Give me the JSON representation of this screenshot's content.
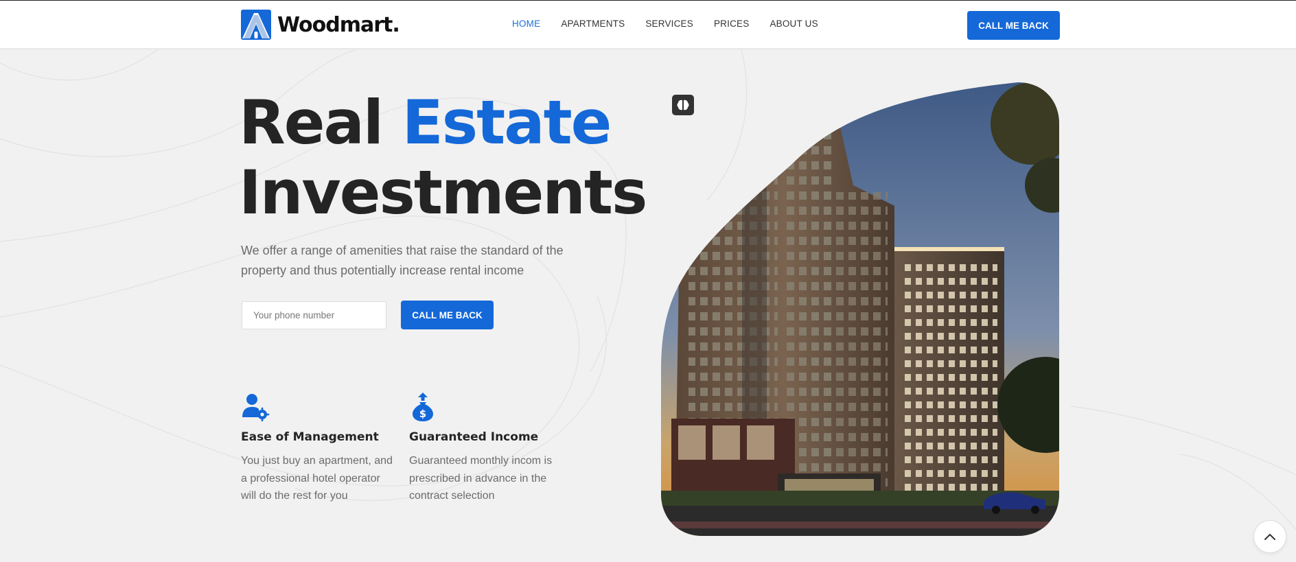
{
  "header": {
    "logo_text": "Woodmart.",
    "nav": [
      "HOME",
      "APARTMENTS",
      "SERVICES",
      "PRICES",
      "ABOUT US"
    ],
    "active_nav": "HOME",
    "cta_label": "CALL ME BACK"
  },
  "hero": {
    "title_part1": "Real ",
    "title_accent": "Estate",
    "title_part2": "Investments",
    "lead": "We offer a range of amenities that raise the standard of the property and thus potentially increase rental income",
    "phone_placeholder": "Your phone number",
    "cta_label": "CALL ME BACK"
  },
  "features": [
    {
      "icon": "user-gear-icon",
      "title": "Ease of Management",
      "text": "You just buy an apartment, and a professional hotel operator will do the rest for you"
    },
    {
      "icon": "money-bag-up-icon",
      "title": "Guaranteed Income",
      "text": "Guaranteed monthly incom is prescribed in advance in the contract selection"
    }
  ],
  "colors": {
    "accent": "#1468d8",
    "text": "#242424",
    "muted": "#6b6b6b",
    "background": "#f1f1f1"
  },
  "icons": {
    "image_badge": "brain-icon",
    "scroll_top": "chevron-up-icon"
  }
}
